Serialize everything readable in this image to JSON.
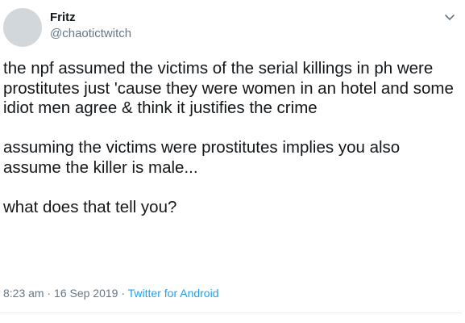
{
  "tweet": {
    "author_name": "Fritz",
    "author_handle": "@chaotictwitch",
    "paragraphs": [
      "the npf assumed the victims of the serial killings in ph were prostitutes just 'cause they were women in an hotel and some idiot men agree & think it justifies the crime",
      "assuming the victims were prostitutes implies you also assume the killer is male...",
      "what does that tell you?"
    ],
    "time": "8:23 am",
    "separator": " · ",
    "date": "16 Sep 2019",
    "source": "Twitter for Android"
  },
  "icons": {
    "menu": "chevron-down-icon"
  },
  "colors": {
    "text": "#14171a",
    "secondary": "#657786",
    "link": "#1da1f2",
    "divider": "#e6ecf0",
    "avatar_placeholder": "#d2d7dc"
  }
}
